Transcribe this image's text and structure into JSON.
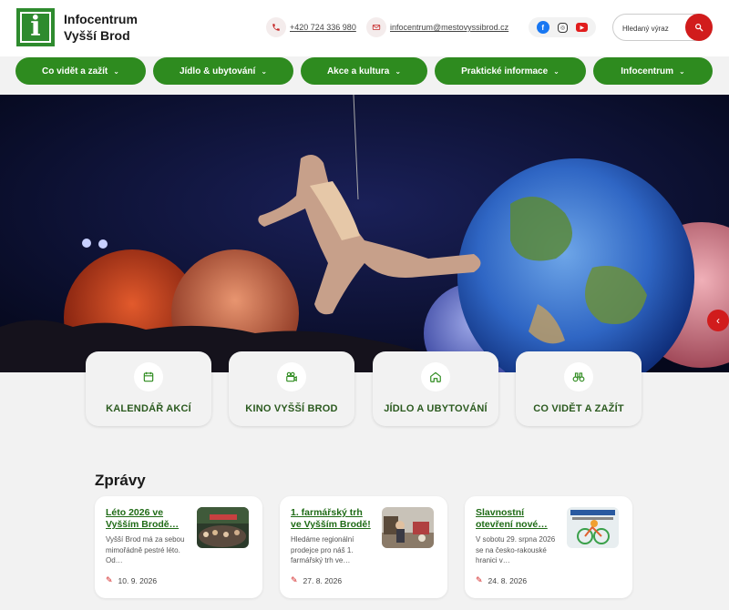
{
  "brand": {
    "logo_letter": "i",
    "name_line1": "Infocentrum",
    "name_line2": "Vyšší Brod",
    "accent": "#2e8b1f",
    "red": "#d11c1c"
  },
  "contacts": {
    "phone": "+420 724 336 980",
    "email": "infocentrum@mestovyssibrod.cz"
  },
  "social": {
    "facebook": "f",
    "instagram": "◎",
    "youtube": "▶"
  },
  "search": {
    "placeholder": "Hledaný výraz"
  },
  "nav": [
    {
      "label": "Co vidět a zažít"
    },
    {
      "label": "Jídlo & ubytování"
    },
    {
      "label": "Akce a kultura"
    },
    {
      "label": "Praktické informace"
    },
    {
      "label": "Infocentrum"
    }
  ],
  "tiles": [
    {
      "label": "KALENDÁŘ AKCÍ",
      "icon": "calendar-icon"
    },
    {
      "label": "KINO VYŠŠÍ BROD",
      "icon": "film-camera-icon"
    },
    {
      "label": "JÍDLO A UBYTOVÁNÍ",
      "icon": "home-icon"
    },
    {
      "label": "CO VIDĚT A ZAŽÍT",
      "icon": "binoculars-icon"
    }
  ],
  "news": {
    "heading": "Zprávy",
    "items": [
      {
        "title": "Léto 2026 ve Vyšším Brodě…",
        "text": "Vyšší Brod má za sebou mimořádně pestré léto. Od…",
        "date": "10. 9. 2026"
      },
      {
        "title": "1. farmářský trh ve Vyšším Brodě!",
        "text": "Hledáme regionální prodejce pro náš 1. farmářský trh ve…",
        "date": "27. 8. 2026"
      },
      {
        "title": "Slavnostní otevření nové…",
        "text": "V sobotu 29. srpna 2026 se na česko-rakouské hranici v…",
        "date": "24. 8. 2026"
      }
    ]
  }
}
